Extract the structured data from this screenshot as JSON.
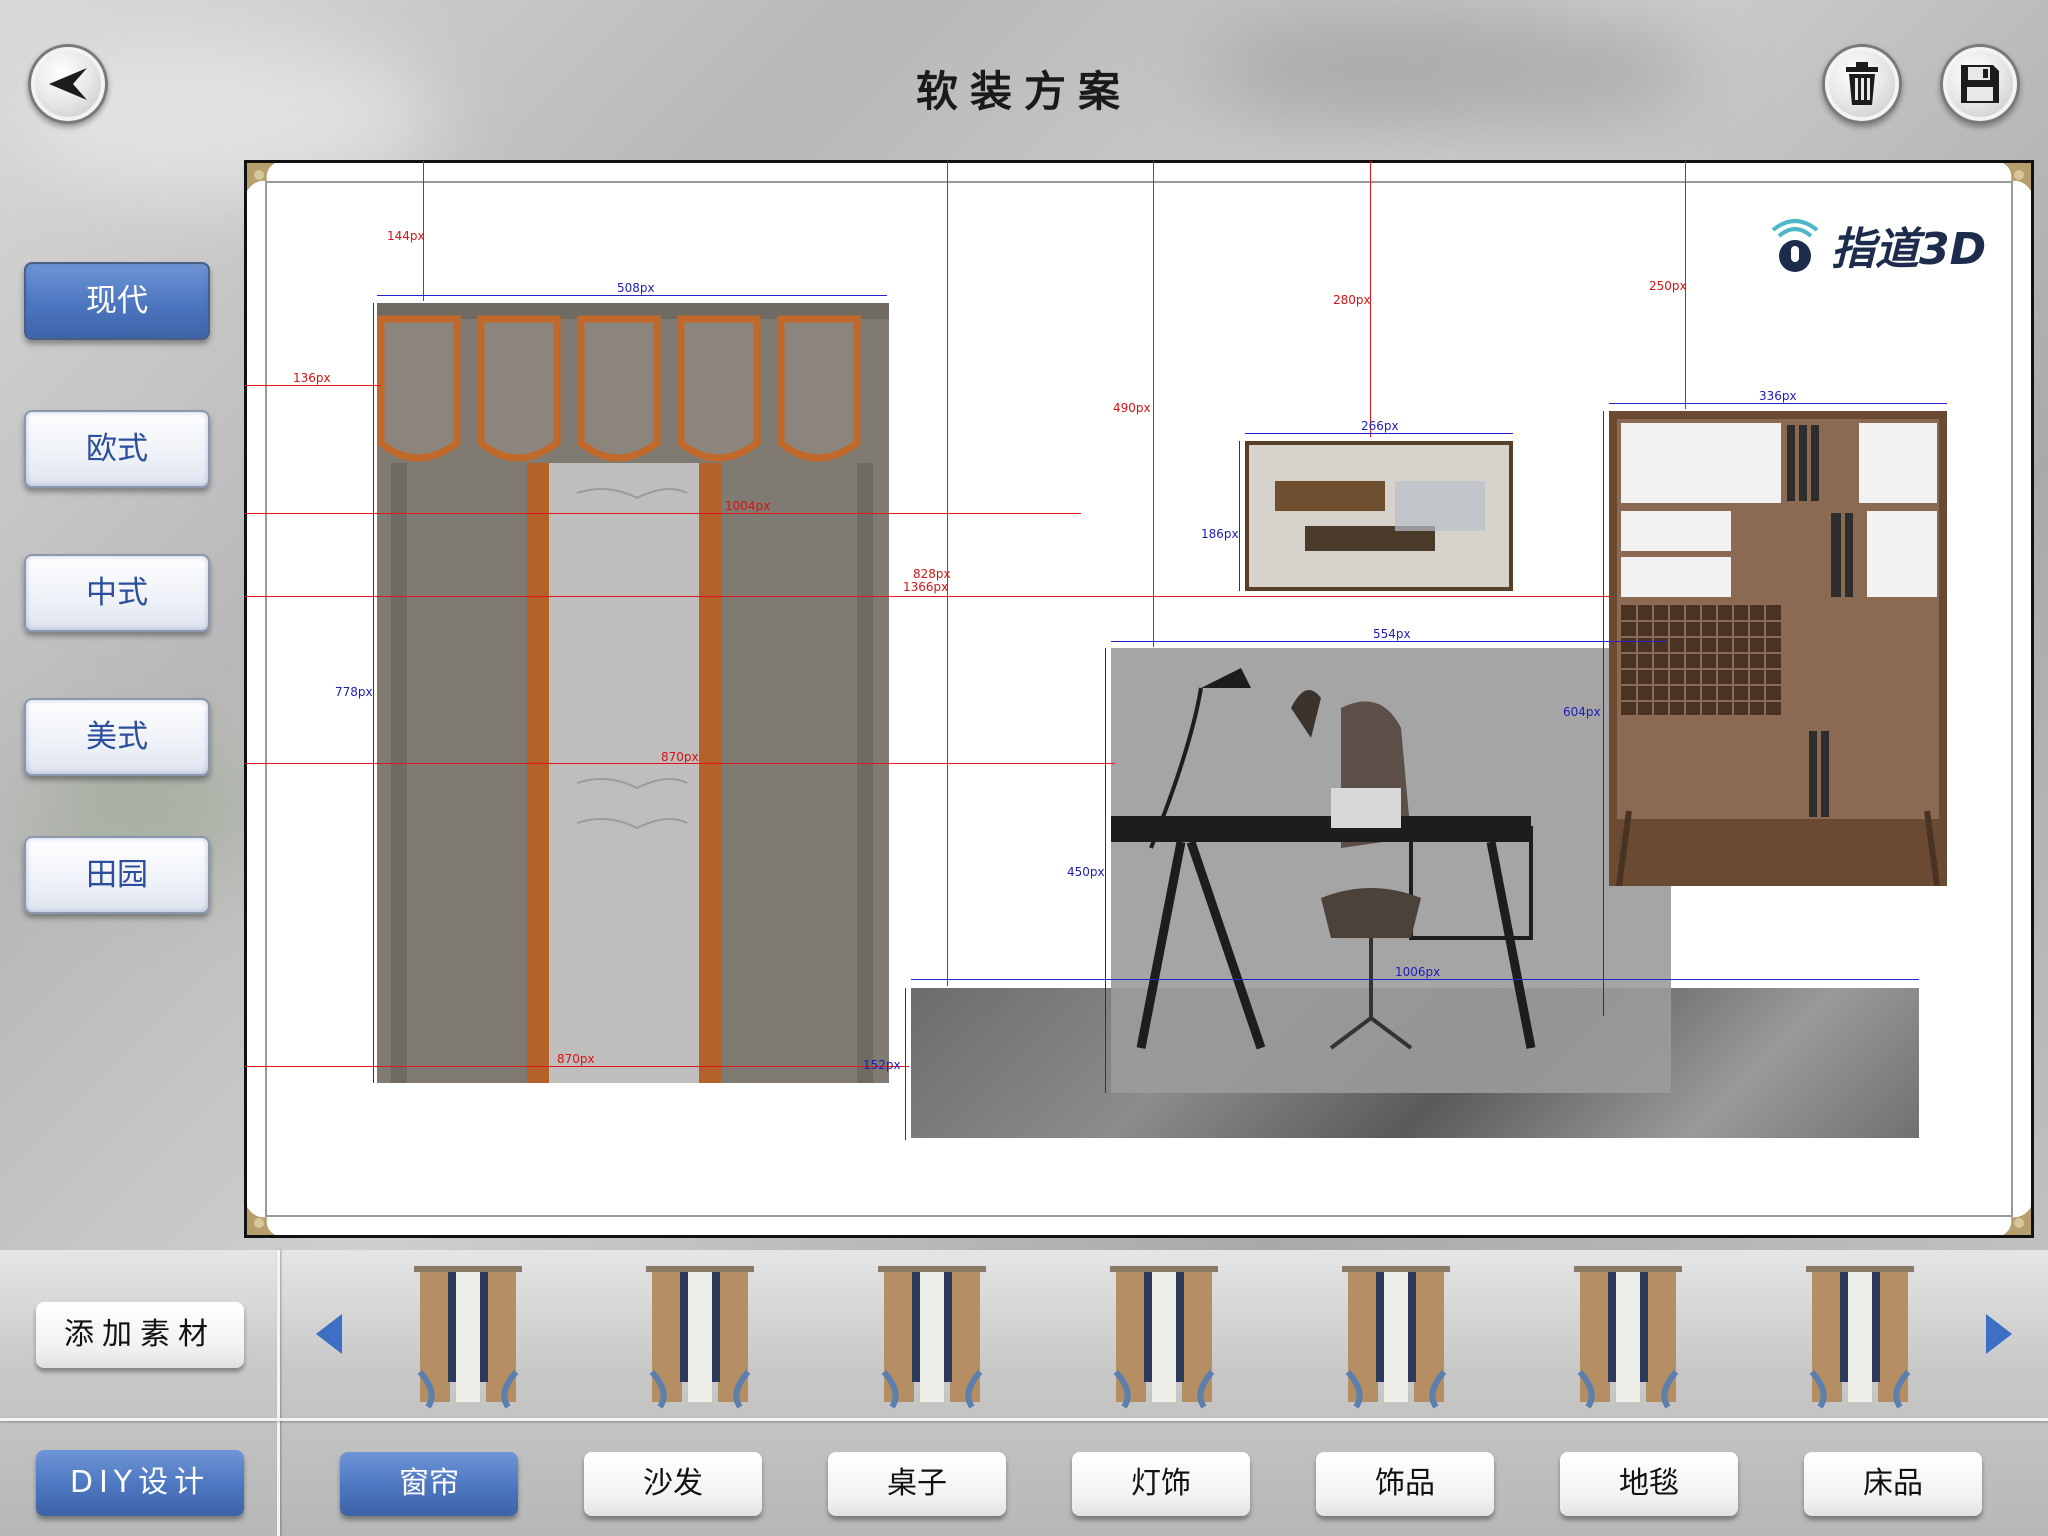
{
  "header": {
    "title": "软装方案"
  },
  "styles": [
    {
      "label": "现代",
      "active": true
    },
    {
      "label": "欧式",
      "active": false
    },
    {
      "label": "中式",
      "active": false
    },
    {
      "label": "美式",
      "active": false
    },
    {
      "label": "田园",
      "active": false
    }
  ],
  "canvas": {
    "logo_text": "指道3D",
    "dimensions": [
      "144px",
      "508px",
      "136px",
      "1004px",
      "778px",
      "870px",
      "870px",
      "152px",
      "490px",
      "828px",
      "1366px",
      "280px",
      "266px",
      "186px",
      "554px",
      "250px",
      "336px",
      "604px",
      "450px",
      "1006px"
    ]
  },
  "bottom": {
    "add_label": "添加素材",
    "diy_label": "DIY设计",
    "thumbnail_count": 7,
    "categories": [
      {
        "label": "窗帘",
        "active": true
      },
      {
        "label": "沙发",
        "active": false
      },
      {
        "label": "桌子",
        "active": false
      },
      {
        "label": "灯饰",
        "active": false
      },
      {
        "label": "饰品",
        "active": false
      },
      {
        "label": "地毯",
        "active": false
      },
      {
        "label": "床品",
        "active": false
      }
    ]
  },
  "icons": {
    "back": "back-arrow-icon",
    "delete": "trash-icon",
    "save": "floppy-disk-icon",
    "prev": "left-triangle-icon",
    "next": "right-triangle-icon"
  },
  "colors": {
    "accent_blue": "#4c76c0",
    "dimension_red": "#e2171b",
    "dimension_blue": "#2323c9"
  }
}
